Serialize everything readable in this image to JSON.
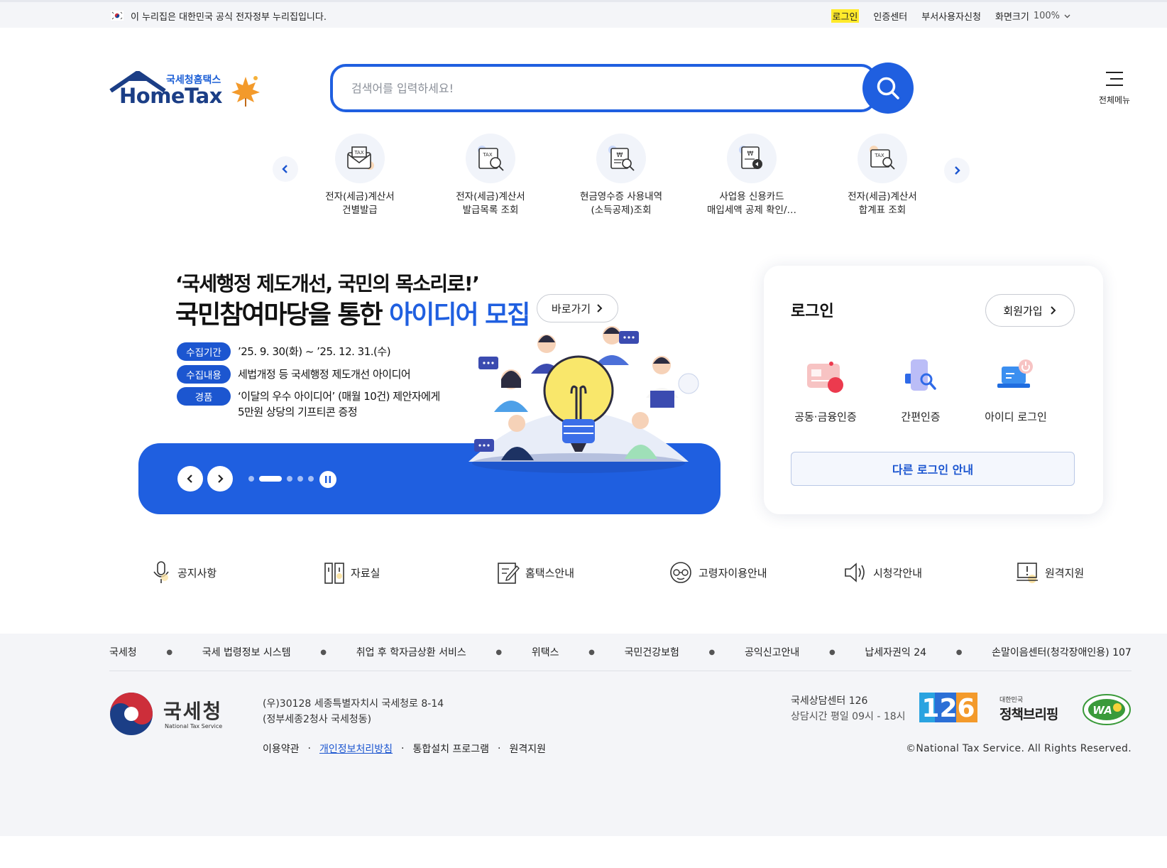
{
  "govbar": {
    "notice": "이 누리집은 대한민국 공식 전자정부 누리집입니다.",
    "login": "로그인",
    "cert_center": "인증센터",
    "dept_user": "부서사용자신청",
    "zoom_label": "화면크기",
    "zoom_value": "100%"
  },
  "header": {
    "logo_sub": "국세청홈택스",
    "logo_main": "HomeTax",
    "search_placeholder": "검색어를 입력하세요!",
    "all_menu": "전체메뉴"
  },
  "quick_menu": [
    {
      "line1": "전자(세금)계산서",
      "line2": "건별발급",
      "icon": "tax-envelope-icon"
    },
    {
      "line1": "전자(세금)계산서",
      "line2": "발급목록 조회",
      "icon": "tax-search-icon"
    },
    {
      "line1": "현금영수증 사용내역",
      "line2": "(소득공제)조회",
      "icon": "receipt-search-icon"
    },
    {
      "line1": "사업용 신용카드",
      "line2": "매입세액 공제 확인/…",
      "icon": "card-receipt-icon"
    },
    {
      "line1": "전자(세금)계산서",
      "line2": "합계표 조회",
      "icon": "tax-sum-icon"
    }
  ],
  "banner": {
    "quote": "‘국세행정 제도개선, 국민의 목소리로!’",
    "headline_pre": "국민참여마당을 통한 ",
    "headline_blue": "아이디어 모집",
    "go_button": "바로가기",
    "rows": [
      {
        "pill": "수집기간",
        "text": "’25. 9. 30(화) ~ ’25. 12. 31.(수)"
      },
      {
        "pill": "수집내용",
        "text": "세법개정 등 국세행정 제도개선 아이디어"
      },
      {
        "pill": "경품",
        "text": "‘이달의 우수 아이디어’ (매월 10건) 제안자에게",
        "text2": "5만원 상당의 기프티콘 증정"
      }
    ]
  },
  "login": {
    "title": "로그인",
    "signup": "회원가입",
    "options": [
      "공동·금융인증",
      "간편인증",
      "아이디 로그인"
    ],
    "other": "다른 로그인 안내"
  },
  "shortcuts": [
    "공지사항",
    "자료실",
    "홈택스안내",
    "고령자이용안내",
    "시청각안내",
    "원격지원"
  ],
  "footer": {
    "links": [
      "국세청",
      "국세 법령정보 시스템",
      "취업 후 학자금상환 서비스",
      "위택스",
      "국민건강보험",
      "공익신고안내",
      "납세자권익 24",
      "손말이음센터(청각장애인용) 107"
    ],
    "org_kr": "국세청",
    "org_en": "National Tax Service",
    "address1": "(우)30128 세종특별자치시 국세청로 8-14",
    "address2": "(정부세종2청사 국세청동)",
    "terms": "이용약관",
    "privacy": "개인정보처리방침",
    "program": "통합설치 프로그램",
    "remote": "원격지원",
    "center_name": "국세상담센터 126",
    "center_hours": "상담시간 평일 09시 - 18시",
    "badge_126": "126",
    "briefing_small": "대한민국",
    "briefing_big": "정책브리핑",
    "wa_mark": "WA",
    "copyright": "©National Tax Service. All Rights Reserved."
  },
  "colors": {
    "primary": "#1f5fe0",
    "navy": "#1b3e86",
    "highlight": "#ffea2b"
  }
}
